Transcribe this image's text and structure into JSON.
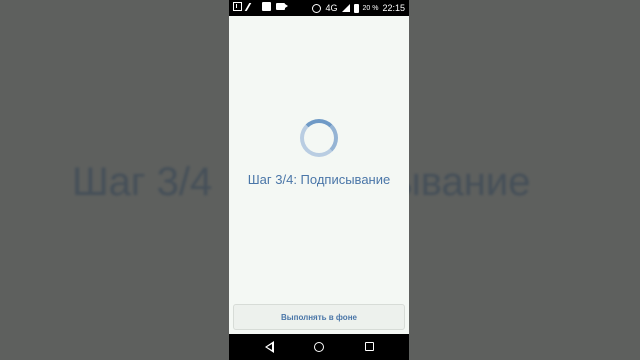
{
  "background_text": {
    "left": "Шаг 3/4",
    "right": "ывание"
  },
  "status_bar": {
    "network": "4G",
    "battery": "20 %",
    "time": "22:15"
  },
  "main": {
    "step_label": "Шаг 3/4: Подписывание",
    "background_button_label": "Выполнять в фоне"
  },
  "colors": {
    "accent": "#4a76a8",
    "screen_bg": "#f4f8f4",
    "spinner": "#6f9ac6"
  },
  "icons": [
    "download-icon",
    "notification-icon",
    "square-icon",
    "video-icon",
    "alarm-icon",
    "signal-icon",
    "battery-icon",
    "back-icon",
    "home-icon",
    "recent-apps-icon"
  ]
}
